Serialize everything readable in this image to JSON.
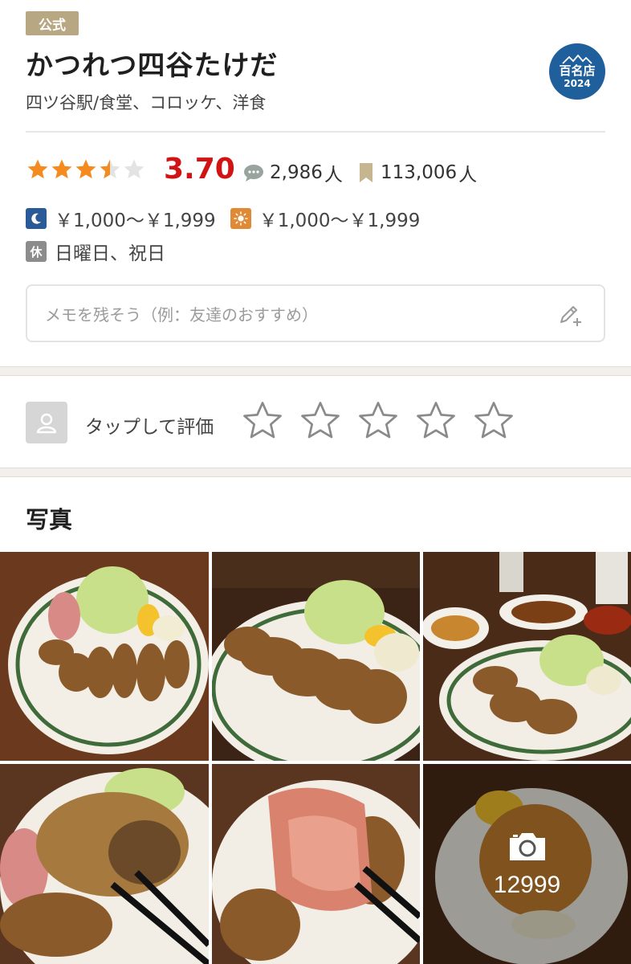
{
  "header": {
    "official_badge": "公式",
    "shop_name": "かつれつ四谷たけだ",
    "genre": "四ツ谷駅/食堂、コロッケ、洋食",
    "award": {
      "label": "百名店",
      "year": "2024",
      "color": "#1f5f9b"
    }
  },
  "stats": {
    "rating": "3.70",
    "rating_value": 3.7,
    "star_color": "#f58b1f",
    "rating_color": "#d11313",
    "reviews_count": "2,986",
    "reviews_unit": "人",
    "saves_count": "113,006",
    "saves_unit": "人",
    "reviews_icon": "comment-icon",
    "saves_icon": "bookmark-icon"
  },
  "price": {
    "dinner_icon": "moon-icon",
    "dinner": "￥1,000～￥1,999",
    "lunch_icon": "sun-icon",
    "lunch": "￥1,000～￥1,999"
  },
  "holiday": {
    "icon_label": "休",
    "text": "日曜日、祝日"
  },
  "memo": {
    "placeholder": "メモを残そう（例：友達のおすすめ）",
    "icon": "edit-pen-plus-icon"
  },
  "my_rating": {
    "label": "タップして評価",
    "stars": 5,
    "avatar_icon": "user-icon"
  },
  "photos": {
    "title": "写真",
    "more_count": "12999",
    "more_icon": "camera-icon"
  }
}
